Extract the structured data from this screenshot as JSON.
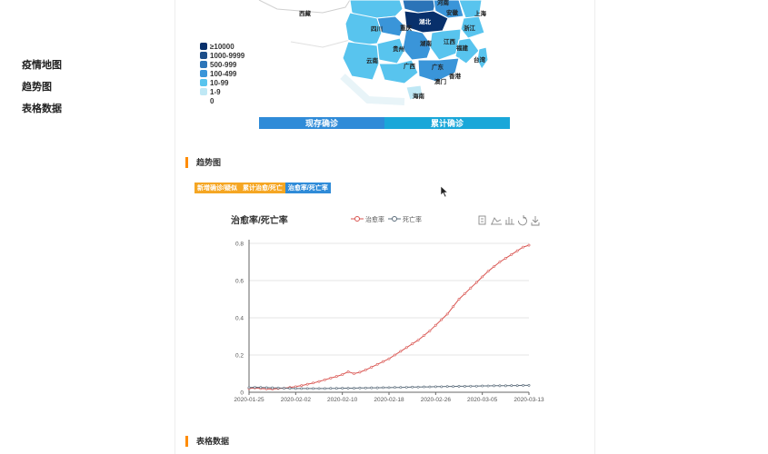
{
  "nav": {
    "items": [
      {
        "label": "疫情地图"
      },
      {
        "label": "趋势图"
      },
      {
        "label": "表格数据"
      }
    ]
  },
  "map": {
    "legend": [
      {
        "label": "≥10000",
        "color": "#08306b"
      },
      {
        "label": "1000-9999",
        "color": "#1d4e89"
      },
      {
        "label": "500-999",
        "color": "#2b74b8"
      },
      {
        "label": "100-499",
        "color": "#3a95d9"
      },
      {
        "label": "10-99",
        "color": "#58c4ee"
      },
      {
        "label": "1-9",
        "color": "#bfe8f5"
      },
      {
        "label": "0",
        "color": "#ffffff"
      }
    ],
    "provinces": [
      "西藏",
      "河南",
      "安徽",
      "湖北",
      "上海",
      "四川",
      "重庆",
      "浙江",
      "湖南",
      "江西",
      "福建",
      "贵州",
      "云南",
      "广西",
      "广东",
      "台湾",
      "澳门",
      "香港",
      "海南"
    ],
    "toggle": {
      "current": "现存确诊",
      "total": "累计确诊"
    }
  },
  "trend": {
    "section_title": "趋势图",
    "tabs": [
      {
        "label": "新增确诊/疑似",
        "color": "#f5a623"
      },
      {
        "label": "累计治愈/死亡",
        "color": "#f5a623"
      },
      {
        "label": "治愈率/死亡率",
        "color": "#2f8bd8"
      }
    ]
  },
  "table_section": {
    "title": "表格数据"
  },
  "chart_data": {
    "type": "line",
    "title": "治愈率/死亡率",
    "x": [
      "2020-01-25",
      "2020-01-26",
      "2020-01-27",
      "2020-01-28",
      "2020-01-29",
      "2020-01-30",
      "2020-01-31",
      "2020-02-01",
      "2020-02-02",
      "2020-02-03",
      "2020-02-04",
      "2020-02-05",
      "2020-02-06",
      "2020-02-07",
      "2020-02-08",
      "2020-02-09",
      "2020-02-10",
      "2020-02-11",
      "2020-02-12",
      "2020-02-13",
      "2020-02-14",
      "2020-02-15",
      "2020-02-16",
      "2020-02-17",
      "2020-02-18",
      "2020-02-19",
      "2020-02-20",
      "2020-02-21",
      "2020-02-22",
      "2020-02-23",
      "2020-02-24",
      "2020-02-25",
      "2020-02-26",
      "2020-02-27",
      "2020-02-28",
      "2020-02-29",
      "2020-03-01",
      "2020-03-02",
      "2020-03-03",
      "2020-03-04",
      "2020-03-05",
      "2020-03-06",
      "2020-03-07",
      "2020-03-08",
      "2020-03-09",
      "2020-03-10",
      "2020-03-11",
      "2020-03-12",
      "2020-03-13"
    ],
    "x_ticks": [
      "2020-01-25",
      "2020-02-02",
      "2020-02-10",
      "2020-02-18",
      "2020-02-26",
      "2020-03-05",
      "2020-03-13"
    ],
    "ylim": [
      0,
      0.8
    ],
    "y_ticks": [
      "0",
      "0.2",
      "0.4",
      "0.6",
      "0.8"
    ],
    "legend_position": "top-center",
    "grid": true,
    "series": [
      {
        "name": "治愈率",
        "color": "#d9534f",
        "values": [
          0.02,
          0.023,
          0.02,
          0.018,
          0.017,
          0.02,
          0.022,
          0.026,
          0.03,
          0.036,
          0.043,
          0.05,
          0.058,
          0.067,
          0.076,
          0.085,
          0.095,
          0.11,
          0.1,
          0.108,
          0.12,
          0.135,
          0.15,
          0.165,
          0.18,
          0.2,
          0.22,
          0.24,
          0.26,
          0.28,
          0.305,
          0.33,
          0.36,
          0.39,
          0.42,
          0.46,
          0.5,
          0.53,
          0.56,
          0.59,
          0.62,
          0.65,
          0.675,
          0.7,
          0.72,
          0.74,
          0.76,
          0.78,
          0.79
        ]
      },
      {
        "name": "死亡率",
        "color": "#5a6b7a",
        "values": [
          0.025,
          0.027,
          0.026,
          0.025,
          0.024,
          0.023,
          0.022,
          0.021,
          0.02,
          0.02,
          0.02,
          0.02,
          0.02,
          0.02,
          0.021,
          0.021,
          0.022,
          0.022,
          0.022,
          0.023,
          0.023,
          0.024,
          0.024,
          0.025,
          0.025,
          0.026,
          0.026,
          0.027,
          0.028,
          0.028,
          0.029,
          0.029,
          0.03,
          0.03,
          0.031,
          0.031,
          0.032,
          0.032,
          0.033,
          0.033,
          0.034,
          0.034,
          0.035,
          0.035,
          0.035,
          0.036,
          0.036,
          0.037,
          0.037
        ]
      }
    ]
  }
}
